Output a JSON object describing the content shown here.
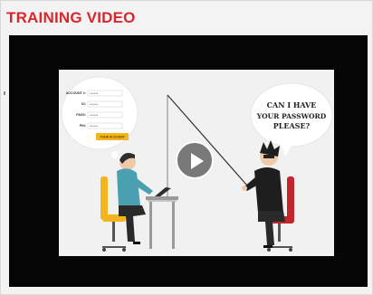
{
  "section": {
    "title": "TRAINING VIDEO"
  },
  "video": {
    "speech": {
      "line1": "CAN I HAVE",
      "line2": "YOUR PASSWORD",
      "line3": "PLEASE?"
    },
    "form": {
      "fields": [
        {
          "label": "ACCOUNT #:",
          "value": "******"
        },
        {
          "label": "ID:",
          "value": "******"
        },
        {
          "label": "PASS:",
          "value": "******"
        },
        {
          "label": "PIN:",
          "value": "******"
        }
      ],
      "button_label": "YOUR ACCOUNT"
    },
    "play_icon": "play-icon"
  },
  "colors": {
    "title": "#d9262b",
    "player_bg": "#050505",
    "chair": "#f2b51d",
    "chair_red": "#c3252c"
  }
}
